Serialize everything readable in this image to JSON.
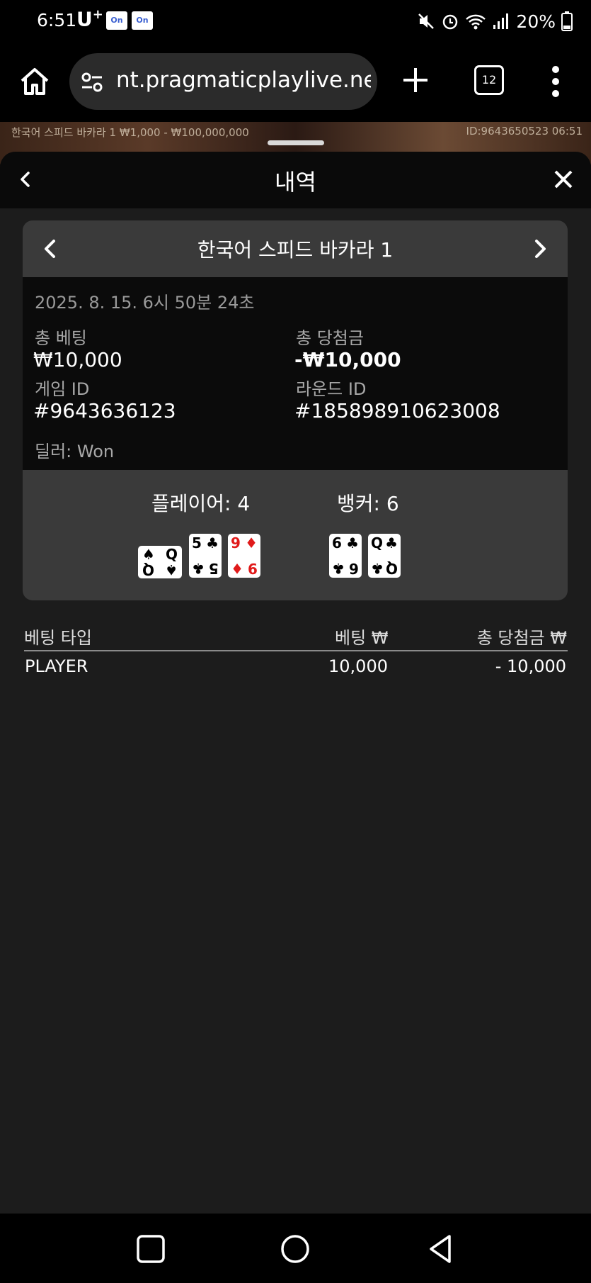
{
  "status_bar": {
    "time": "6:51",
    "carrier": "U",
    "carrier_sup": "+",
    "app_icons": [
      "On",
      "On"
    ],
    "battery": "20%"
  },
  "browser": {
    "url": "nt.pragmaticplaylive.net",
    "tab_count": "12"
  },
  "game_strip": {
    "left_text": "한국어 스피드 바카라 1  ₩1,000 - ₩100,000,000",
    "right_text": "ID:9643650523  06:51"
  },
  "sheet": {
    "title": "내역",
    "table_name": "한국어 스피드 바카라 1",
    "datetime": "2025. 8. 15. 6시 50분 24초",
    "total_bet_label": "총 베팅",
    "total_bet_value": "₩10,000",
    "total_win_label": "총 당첨금",
    "total_win_value": "-₩10,000",
    "game_id_label": "게임 ID",
    "game_id_value": "#9643636123",
    "round_id_label": "라운드 ID",
    "round_id_value": "#185898910623008",
    "dealer": "딜러: Won",
    "player_label": "플레이어: 4",
    "banker_label": "뱅커: 6",
    "player_cards": [
      {
        "rank": "Q",
        "suit": "♠",
        "color": "black"
      },
      {
        "rank": "5",
        "suit": "♣",
        "color": "black"
      },
      {
        "rank": "9",
        "suit": "♦",
        "color": "red"
      }
    ],
    "banker_cards": [
      {
        "rank": "6",
        "suit": "♣",
        "color": "black"
      },
      {
        "rank": "Q",
        "suit": "♣",
        "color": "black"
      }
    ]
  },
  "bet_table": {
    "headers": [
      "베팅 타입",
      "베팅 ₩",
      "총 당첨금 ₩"
    ],
    "rows": [
      [
        "PLAYER",
        "10,000",
        "- 10,000"
      ]
    ]
  },
  "colors": {
    "sheet_bg": "#1c1c1c",
    "panel_gray": "#3a3a3a",
    "panel_dark": "#0b0b0b",
    "card_red": "#e01a1a"
  }
}
